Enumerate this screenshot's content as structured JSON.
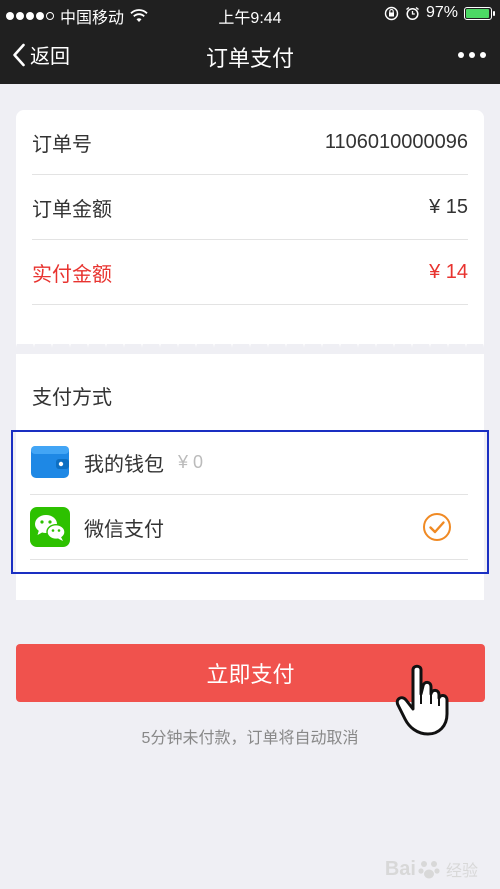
{
  "status_bar": {
    "carrier": "中国移动",
    "time": "上午9:44",
    "battery": "97%",
    "signal_icon": "signal-dots-icon",
    "wifi_icon": "wifi-icon"
  },
  "nav": {
    "back_label": "返回",
    "title": "订单支付",
    "more_icon": "more-dots-icon"
  },
  "order": {
    "rows": [
      {
        "label": "订单号",
        "value": "1106010000096"
      },
      {
        "label": "订单金额",
        "value": "¥ 15"
      },
      {
        "label": "实付金额",
        "value": "¥ 14"
      }
    ]
  },
  "payment": {
    "section_title": "支付方式",
    "methods": [
      {
        "name": "我的钱包",
        "balance": "¥ 0",
        "icon": "wallet-icon",
        "selected": false
      },
      {
        "name": "微信支付",
        "icon": "wechat-icon",
        "selected": true
      }
    ]
  },
  "actions": {
    "pay_label": "立即支付",
    "hint": "5分钟未付款，订单将自动取消"
  },
  "watermark": {
    "text": "Bai",
    "sub": "经验"
  },
  "colors": {
    "accent_red": "#e8332f",
    "button_red": "#f0524d",
    "wechat_green": "#2dc100",
    "wallet_blue": "#1e88e5",
    "check_orange": "#f08a24",
    "highlight_blue": "#1a2fc2"
  }
}
